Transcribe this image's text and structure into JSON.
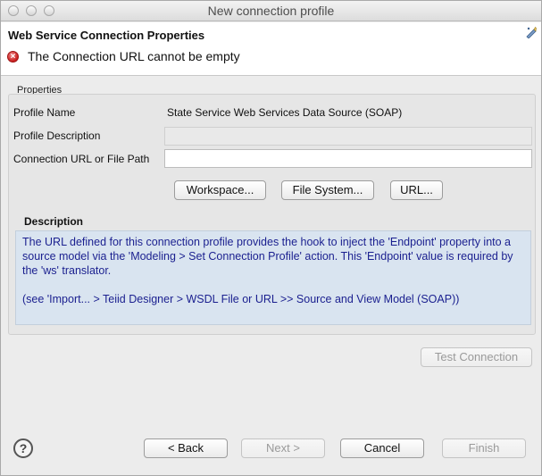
{
  "window": {
    "title": "New connection profile"
  },
  "header": {
    "title": "Web Service Connection Properties",
    "error_message": "The Connection URL cannot be empty"
  },
  "properties": {
    "group_label": "Properties",
    "profile_name_label": "Profile Name",
    "profile_name_value": "State Service Web Services Data Source (SOAP)",
    "profile_description_label": "Profile Description",
    "profile_description_value": "",
    "connection_url_label": "Connection URL or File Path",
    "connection_url_value": "",
    "workspace_button": "Workspace...",
    "filesystem_button": "File System...",
    "url_button": "URL...",
    "description_title": "Description",
    "description_text_1": "The URL defined for this connection profile provides the hook to inject the 'Endpoint' property into a source model via the 'Modeling > Set Connection Profile' action. This 'Endpoint' value is required by the 'ws' translator.",
    "description_text_2": "(see 'Import... > Teiid Designer > WSDL File or URL >> Source and View Model (SOAP))"
  },
  "buttons": {
    "test_connection": "Test Connection",
    "back": "< Back",
    "next": "Next >",
    "cancel": "Cancel",
    "finish": "Finish"
  },
  "icons": {
    "error": "error-icon",
    "help": "help-icon",
    "corner": "wizard-banner-icon"
  },
  "colors": {
    "description_bg": "#d9e4f0",
    "description_text": "#1a1f8f",
    "error": "#c91d1d"
  }
}
